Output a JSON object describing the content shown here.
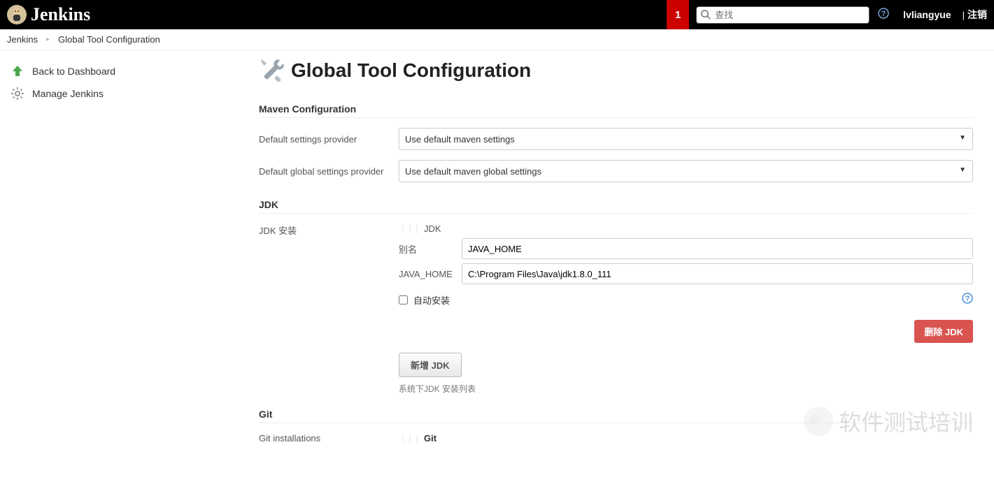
{
  "header": {
    "logo_text": "Jenkins",
    "badge_count": "1",
    "search_placeholder": "查找",
    "username": "lvliangyue",
    "logout_label": "注销"
  },
  "breadcrumbs": [
    {
      "label": "Jenkins"
    },
    {
      "label": "Global Tool Configuration"
    }
  ],
  "sidebar": {
    "back_to_dashboard": "Back to Dashboard",
    "manage_jenkins": "Manage Jenkins"
  },
  "page": {
    "title": "Global Tool Configuration"
  },
  "maven": {
    "section_title": "Maven Configuration",
    "default_settings_label": "Default settings provider",
    "default_settings_value": "Use default maven settings",
    "global_settings_label": "Default global settings provider",
    "global_settings_value": "Use default maven global settings"
  },
  "jdk": {
    "section_title": "JDK",
    "install_label": "JDK 安装",
    "name_heading": "JDK",
    "alias_label": "别名",
    "alias_value": "JAVA_HOME",
    "java_home_label": "JAVA_HOME",
    "java_home_value": "C:\\Program Files\\Java\\jdk1.8.0_111",
    "auto_install_label": "自动安装",
    "auto_install_checked": false,
    "delete_button": "删除 JDK",
    "add_button": "新增 JDK",
    "list_helper": "系统下JDK 安装列表"
  },
  "git": {
    "section_title": "Git",
    "installations_label": "Git installations",
    "name_heading": "Git"
  },
  "watermark": {
    "text": "软件测试培训"
  }
}
